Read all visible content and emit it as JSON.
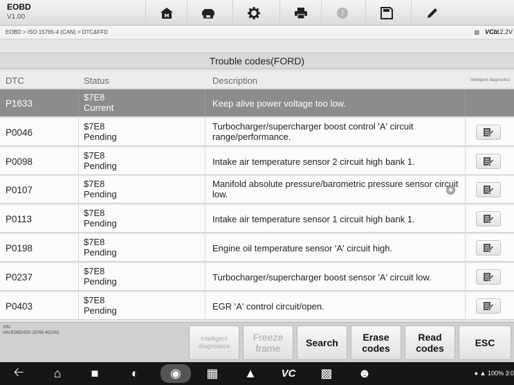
{
  "app": {
    "title": "EOBD",
    "version": "V1.00"
  },
  "toolbar": {
    "icons": [
      "home-icon",
      "vehicle-swap-icon",
      "settings-icon",
      "print-icon",
      "help-icon",
      "save-icon",
      "edit-icon"
    ]
  },
  "breadcrumb": "EOBD > ISO 15765-4 (CAN) > DTC&FFD",
  "vci": {
    "label": "VCb",
    "battery_text": "12.2V"
  },
  "panel": {
    "title": "Trouble codes(FORD)"
  },
  "table": {
    "headers": {
      "dtc": "DTC",
      "status": "Status",
      "description": "Description",
      "intelligent": "Intelligent diagnostics"
    },
    "rows": [
      {
        "dtc": "P1633",
        "status_code": "$7E8",
        "status_text": "Current",
        "description": "Keep alive power voltage too low.",
        "selected": true,
        "has_info": false,
        "has_button": false
      },
      {
        "dtc": "P0046",
        "status_code": "$7E8",
        "status_text": "Pending",
        "description": "Turbocharger/supercharger boost control 'A' circuit range/performance.",
        "selected": false,
        "has_info": false,
        "has_button": true
      },
      {
        "dtc": "P0098",
        "status_code": "$7E8",
        "status_text": "Pending",
        "description": "Intake air temperature sensor 2 circuit high bank 1.",
        "selected": false,
        "has_info": false,
        "has_button": true
      },
      {
        "dtc": "P0107",
        "status_code": "$7E8",
        "status_text": "Pending",
        "description": "Manifold absolute pressure/barometric pressure sensor circuit low.",
        "selected": false,
        "has_info": true,
        "has_button": true
      },
      {
        "dtc": "P0113",
        "status_code": "$7E8",
        "status_text": "Pending",
        "description": "Intake air temperature sensor 1 circuit high bank 1.",
        "selected": false,
        "has_info": false,
        "has_button": true
      },
      {
        "dtc": "P0198",
        "status_code": "$7E8",
        "status_text": "Pending",
        "description": "Engine oil temperature sensor 'A' circuit high.",
        "selected": false,
        "has_info": false,
        "has_button": true
      },
      {
        "dtc": "P0237",
        "status_code": "$7E8",
        "status_text": "Pending",
        "description": "Turbocharger/supercharger boost sensor 'A' circuit low.",
        "selected": false,
        "has_info": false,
        "has_button": true
      },
      {
        "dtc": "P0403",
        "status_code": "$7E8",
        "status_text": "Pending",
        "description": "EGR 'A' control circuit/open.",
        "selected": false,
        "has_info": false,
        "has_button": true
      }
    ]
  },
  "footer": {
    "vin_label": "VIN:",
    "info_label": "Info:EOBD/ISO 15765-4(CAN)",
    "buttons": {
      "intelligent": "Intelligent diagnostics",
      "freeze": "Freeze frame",
      "search": "Search",
      "erase": "Erase codes",
      "read": "Read codes",
      "esc": "ESC"
    }
  },
  "system_status": {
    "battery": "100%",
    "time": "3:0"
  },
  "colors": {
    "selected_row": "#8c8c8c",
    "nav_bar": "#161616"
  }
}
